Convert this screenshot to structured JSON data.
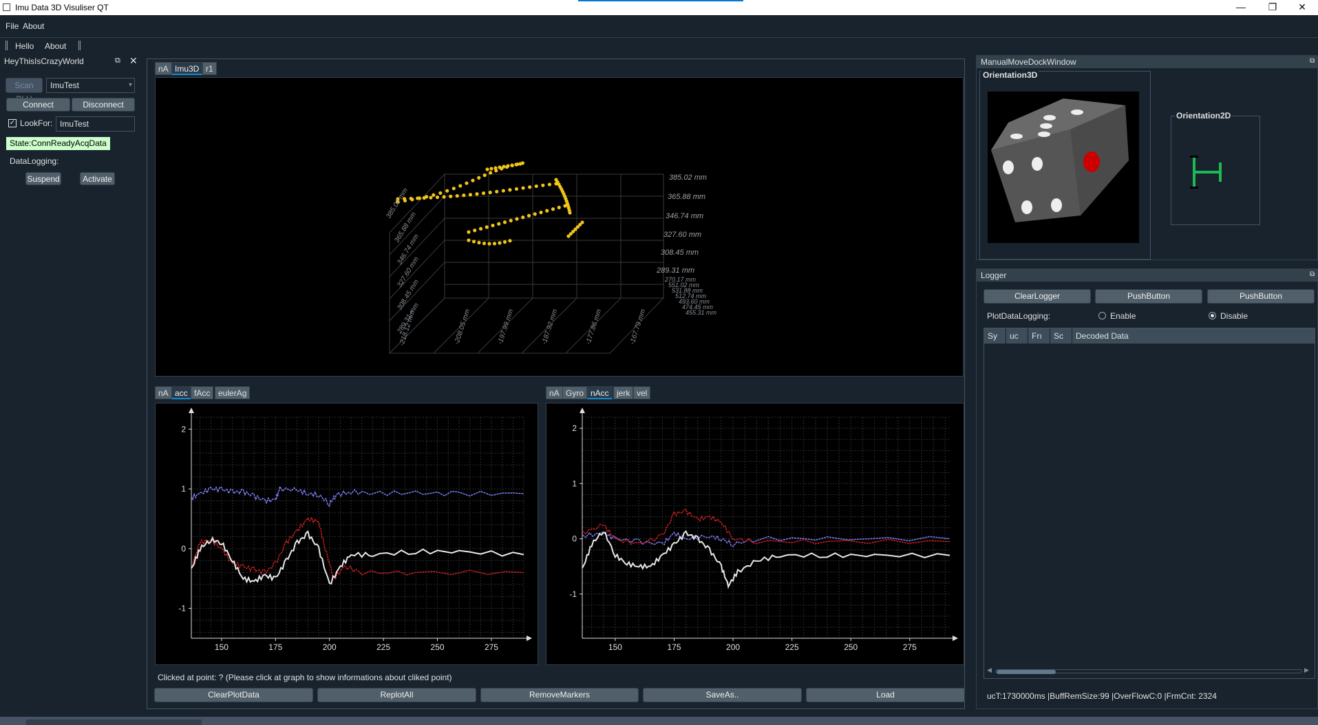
{
  "window": {
    "title": "Imu Data 3D Visuliser QT",
    "minimize": "—",
    "maximize": "❐",
    "close": "✕"
  },
  "menu": {
    "file": "File",
    "about": "About"
  },
  "toolbar": {
    "hello": "Hello",
    "about": "About"
  },
  "left_dock": {
    "title": "HeyThisIsCrazyWorld",
    "scan_button": "Scan BLU",
    "device_select": "ImuTest",
    "connect": "Connect",
    "disconnect": "Disconnect",
    "lookfor_label": "LookFor:",
    "lookfor_value": "ImuTest",
    "state": "State:ConnReadyAcqData",
    "datalogging_label": "DataLogging:",
    "suspend": "Suspend",
    "activate": "Activate"
  },
  "center": {
    "top_tabs": [
      "nA",
      "Imu3D",
      "r1"
    ],
    "left_tabs": [
      "nA",
      "acc",
      "fAcc",
      "eulerAg"
    ],
    "right_tabs": [
      "nA",
      "Gyro",
      "nAcc",
      "jerk",
      "vel"
    ],
    "scatter_z_labels": [
      "385.02 mm",
      "365.88 mm",
      "346.74 mm",
      "327.60 mm",
      "308.45 mm",
      "289.31 mm"
    ],
    "scatter_y_labels": [
      "270.17 mm",
      "551.02 mm",
      "531.88 mm",
      "512.74 mm",
      "493.60 mm",
      "474.45 mm",
      "455.31 mm"
    ],
    "scatter_x_labels": [
      "-218.12 mm",
      "-208.05 mm",
      "-197.99 mm",
      "-187.92 mm",
      "-177.86 mm",
      "-167.79 mm"
    ],
    "scatter_left_labels": [
      "385.02 mm",
      "365.88 mm",
      "346.74 mm",
      "327.60 mm",
      "308.45 mm",
      "289.31 mm"
    ],
    "clicked_text": "Clicked at point: ? (Please click at graph to show informations about cliked point)",
    "buttons": [
      "ClearPlotData",
      "ReplotAll",
      "RemoveMarkers",
      "SaveAs..",
      "Load"
    ]
  },
  "chart_data": [
    {
      "type": "line",
      "xlim": [
        136,
        290
      ],
      "ylim": [
        -1.5,
        2.2
      ],
      "x_ticks": [
        150,
        175,
        200,
        225,
        250,
        275
      ],
      "y_ticks": [
        -1,
        0,
        1,
        2
      ],
      "grid": true,
      "series": [
        {
          "color": "#8080ff",
          "points": [
            [
              136,
              0.85
            ],
            [
              140,
              0.92
            ],
            [
              145,
              1.0
            ],
            [
              150,
              0.99
            ],
            [
              155,
              0.95
            ],
            [
              160,
              0.95
            ],
            [
              165,
              0.88
            ],
            [
              170,
              0.8
            ],
            [
              175,
              0.82
            ],
            [
              177,
              1.0
            ],
            [
              185,
              0.98
            ],
            [
              190,
              0.92
            ],
            [
              195,
              0.9
            ],
            [
              200,
              0.75
            ],
            [
              203,
              0.9
            ],
            [
              210,
              0.95
            ],
            [
              220,
              0.93
            ],
            [
              240,
              0.93
            ],
            [
              260,
              0.92
            ],
            [
              290,
              0.92
            ]
          ]
        },
        {
          "color": "#cc2020",
          "points": [
            [
              136,
              -0.3
            ],
            [
              140,
              0.1
            ],
            [
              145,
              0.15
            ],
            [
              150,
              0.0
            ],
            [
              155,
              -0.25
            ],
            [
              160,
              -0.3
            ],
            [
              165,
              -0.35
            ],
            [
              170,
              -0.4
            ],
            [
              175,
              -0.25
            ],
            [
              180,
              0.1
            ],
            [
              185,
              0.3
            ],
            [
              190,
              0.5
            ],
            [
              195,
              0.45
            ],
            [
              198,
              0.0
            ],
            [
              202,
              -0.5
            ],
            [
              207,
              -0.3
            ],
            [
              215,
              -0.4
            ],
            [
              240,
              -0.4
            ],
            [
              290,
              -0.4
            ]
          ]
        },
        {
          "color": "#e8e8e8",
          "points": [
            [
              136,
              -0.35
            ],
            [
              140,
              0.0
            ],
            [
              145,
              0.15
            ],
            [
              150,
              0.1
            ],
            [
              155,
              -0.2
            ],
            [
              160,
              -0.5
            ],
            [
              165,
              -0.55
            ],
            [
              170,
              -0.45
            ],
            [
              175,
              -0.5
            ],
            [
              180,
              -0.2
            ],
            [
              185,
              0.1
            ],
            [
              190,
              0.25
            ],
            [
              195,
              0.0
            ],
            [
              200,
              -0.6
            ],
            [
              205,
              -0.3
            ],
            [
              210,
              -0.1
            ],
            [
              220,
              -0.1
            ],
            [
              240,
              -0.05
            ],
            [
              260,
              -0.05
            ],
            [
              290,
              -0.1
            ]
          ]
        }
      ]
    },
    {
      "type": "line",
      "xlim": [
        136,
        292
      ],
      "ylim": [
        -1.8,
        2.2
      ],
      "x_ticks": [
        150,
        175,
        200,
        225,
        250,
        275
      ],
      "y_ticks": [
        -1,
        0,
        1,
        2
      ],
      "grid": true,
      "series": [
        {
          "color": "#8080ff",
          "points": [
            [
              136,
              0.05
            ],
            [
              145,
              0.1
            ],
            [
              150,
              0.0
            ],
            [
              160,
              -0.05
            ],
            [
              170,
              -0.1
            ],
            [
              175,
              0.1
            ],
            [
              180,
              0.0
            ],
            [
              190,
              0.05
            ],
            [
              195,
              0.0
            ],
            [
              200,
              -0.1
            ],
            [
              210,
              0.0
            ],
            [
              240,
              0.0
            ],
            [
              292,
              0.0
            ]
          ]
        },
        {
          "color": "#cc2020",
          "points": [
            [
              136,
              0.1
            ],
            [
              145,
              0.25
            ],
            [
              150,
              0.0
            ],
            [
              160,
              -0.1
            ],
            [
              170,
              0.05
            ],
            [
              175,
              0.45
            ],
            [
              180,
              0.5
            ],
            [
              185,
              0.35
            ],
            [
              190,
              0.4
            ],
            [
              195,
              0.3
            ],
            [
              200,
              0.0
            ],
            [
              210,
              -0.05
            ],
            [
              240,
              -0.05
            ],
            [
              292,
              -0.05
            ]
          ]
        },
        {
          "color": "#e8e8e8",
          "points": [
            [
              136,
              -0.55
            ],
            [
              140,
              -0.1
            ],
            [
              145,
              0.15
            ],
            [
              150,
              -0.3
            ],
            [
              155,
              -0.45
            ],
            [
              160,
              -0.5
            ],
            [
              165,
              -0.5
            ],
            [
              170,
              -0.3
            ],
            [
              175,
              -0.1
            ],
            [
              180,
              0.1
            ],
            [
              185,
              0.0
            ],
            [
              190,
              -0.2
            ],
            [
              195,
              -0.5
            ],
            [
              198,
              -0.85
            ],
            [
              202,
              -0.6
            ],
            [
              210,
              -0.4
            ],
            [
              220,
              -0.3
            ],
            [
              240,
              -0.3
            ],
            [
              260,
              -0.3
            ],
            [
              292,
              -0.3
            ]
          ]
        }
      ]
    }
  ],
  "right": {
    "manual_title": "ManualMoveDockWindow",
    "orientation3d": "Orientation3D",
    "orientation2d": "Orientation2D",
    "logger_title": "Logger",
    "clear_logger": "ClearLogger",
    "push1": "PushButton",
    "push2": "PushButton",
    "plot_logging_label": "PlotDataLogging:",
    "enable": "Enable",
    "disable": "Disable",
    "table_headers": [
      "Sy",
      "uc",
      "Frı",
      "Sc",
      "Decoded Data"
    ],
    "status": "ucT:1730000ms |BuffRemSize:99 |OverFlowC:0 |FrmCnt: 2324"
  },
  "colors": {
    "bg": "#19232d",
    "accent": "#148cd2",
    "state_bg": "#ccffcc",
    "dots": "#f0c419"
  }
}
